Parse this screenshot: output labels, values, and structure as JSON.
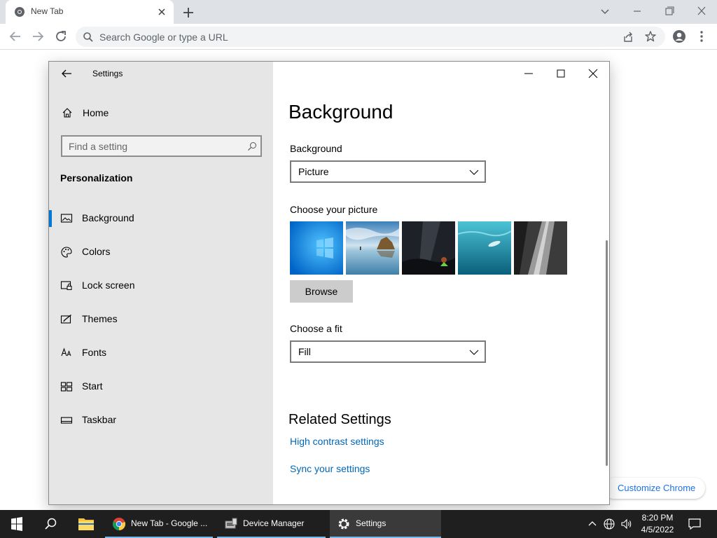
{
  "browser": {
    "tab_title": "New Tab",
    "omnibox_placeholder": "Search Google or type a URL",
    "customize_label": "Customize Chrome"
  },
  "settings": {
    "window_title": "Settings",
    "home_label": "Home",
    "search_placeholder": "Find a setting",
    "section_title": "Personalization",
    "nav_items": [
      {
        "label": "Background",
        "icon": "picture-icon",
        "active": true
      },
      {
        "label": "Colors",
        "icon": "palette-icon",
        "active": false
      },
      {
        "label": "Lock screen",
        "icon": "lock-screen-icon",
        "active": false
      },
      {
        "label": "Themes",
        "icon": "themes-icon",
        "active": false
      },
      {
        "label": "Fonts",
        "icon": "fonts-icon",
        "active": false
      },
      {
        "label": "Start",
        "icon": "start-icon",
        "active": false
      },
      {
        "label": "Taskbar",
        "icon": "taskbar-icon",
        "active": false
      }
    ],
    "page_title": "Background",
    "background_label": "Background",
    "background_value": "Picture",
    "choose_picture_label": "Choose your picture",
    "browse_label": "Browse",
    "fit_label": "Choose a fit",
    "fit_value": "Fill",
    "related_title": "Related Settings",
    "related_links": [
      "High contrast settings",
      "Sync your settings"
    ]
  },
  "taskbar": {
    "apps": [
      {
        "label": "New Tab - Google ...",
        "icon": "chrome-icon"
      },
      {
        "label": "Device Manager",
        "icon": "device-manager-icon"
      },
      {
        "label": "Settings",
        "icon": "gear-icon"
      }
    ],
    "time": "8:20 PM",
    "date": "4/5/2022"
  },
  "colors": {
    "accent": "#0078d7",
    "link": "#0067b8",
    "taskbar": "#1f1f1f"
  }
}
